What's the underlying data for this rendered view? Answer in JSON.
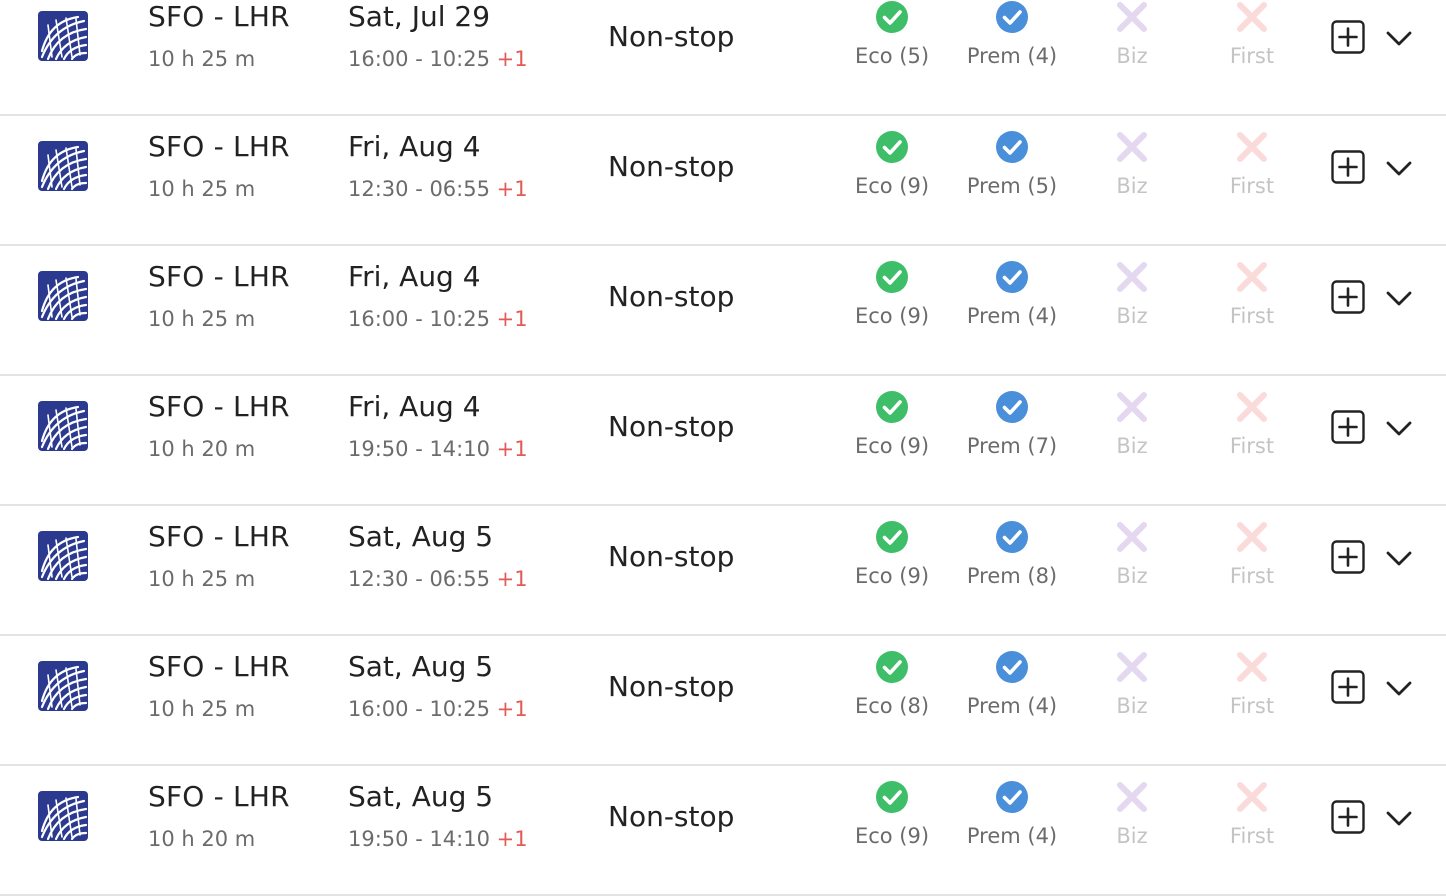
{
  "colors": {
    "airline_logo": "#2b3a8f",
    "available_eco": "#3fbe6a",
    "available_prem": "#4a8fd9",
    "unavailable_biz": "#e3d8f0",
    "unavailable_first": "#fbdada",
    "plus_day": "#e25a55",
    "divider": "#e3e3e3"
  },
  "flights": [
    {
      "route": "SFO - LHR",
      "duration": "10 h 25 m",
      "date": "Sat, Jul 29",
      "times": "16:00 - 10:25",
      "plus_day": "+1",
      "stops": "Non-stop",
      "cabins": [
        {
          "label": "Eco (5)",
          "available": true,
          "icon": "check-circle-green-icon"
        },
        {
          "label": "Prem (4)",
          "available": true,
          "icon": "check-circle-blue-icon"
        },
        {
          "label": "Biz",
          "available": false,
          "icon": "x-lavender-icon"
        },
        {
          "label": "First",
          "available": false,
          "icon": "x-pink-icon"
        }
      ]
    },
    {
      "route": "SFO - LHR",
      "duration": "10 h 25 m",
      "date": "Fri, Aug 4",
      "times": "12:30 - 06:55",
      "plus_day": "+1",
      "stops": "Non-stop",
      "cabins": [
        {
          "label": "Eco (9)",
          "available": true,
          "icon": "check-circle-green-icon"
        },
        {
          "label": "Prem (5)",
          "available": true,
          "icon": "check-circle-blue-icon"
        },
        {
          "label": "Biz",
          "available": false,
          "icon": "x-lavender-icon"
        },
        {
          "label": "First",
          "available": false,
          "icon": "x-pink-icon"
        }
      ]
    },
    {
      "route": "SFO - LHR",
      "duration": "10 h 25 m",
      "date": "Fri, Aug 4",
      "times": "16:00 - 10:25",
      "plus_day": "+1",
      "stops": "Non-stop",
      "cabins": [
        {
          "label": "Eco (9)",
          "available": true,
          "icon": "check-circle-green-icon"
        },
        {
          "label": "Prem (4)",
          "available": true,
          "icon": "check-circle-blue-icon"
        },
        {
          "label": "Biz",
          "available": false,
          "icon": "x-lavender-icon"
        },
        {
          "label": "First",
          "available": false,
          "icon": "x-pink-icon"
        }
      ]
    },
    {
      "route": "SFO - LHR",
      "duration": "10 h 20 m",
      "date": "Fri, Aug 4",
      "times": "19:50 - 14:10",
      "plus_day": "+1",
      "stops": "Non-stop",
      "cabins": [
        {
          "label": "Eco (9)",
          "available": true,
          "icon": "check-circle-green-icon"
        },
        {
          "label": "Prem (7)",
          "available": true,
          "icon": "check-circle-blue-icon"
        },
        {
          "label": "Biz",
          "available": false,
          "icon": "x-lavender-icon"
        },
        {
          "label": "First",
          "available": false,
          "icon": "x-pink-icon"
        }
      ]
    },
    {
      "route": "SFO - LHR",
      "duration": "10 h 25 m",
      "date": "Sat, Aug 5",
      "times": "12:30 - 06:55",
      "plus_day": "+1",
      "stops": "Non-stop",
      "cabins": [
        {
          "label": "Eco (9)",
          "available": true,
          "icon": "check-circle-green-icon"
        },
        {
          "label": "Prem (8)",
          "available": true,
          "icon": "check-circle-blue-icon"
        },
        {
          "label": "Biz",
          "available": false,
          "icon": "x-lavender-icon"
        },
        {
          "label": "First",
          "available": false,
          "icon": "x-pink-icon"
        }
      ]
    },
    {
      "route": "SFO - LHR",
      "duration": "10 h 25 m",
      "date": "Sat, Aug 5",
      "times": "16:00 - 10:25",
      "plus_day": "+1",
      "stops": "Non-stop",
      "cabins": [
        {
          "label": "Eco (8)",
          "available": true,
          "icon": "check-circle-green-icon"
        },
        {
          "label": "Prem (4)",
          "available": true,
          "icon": "check-circle-blue-icon"
        },
        {
          "label": "Biz",
          "available": false,
          "icon": "x-lavender-icon"
        },
        {
          "label": "First",
          "available": false,
          "icon": "x-pink-icon"
        }
      ]
    },
    {
      "route": "SFO - LHR",
      "duration": "10 h 20 m",
      "date": "Sat, Aug 5",
      "times": "19:50 - 14:10",
      "plus_day": "+1",
      "stops": "Non-stop",
      "cabins": [
        {
          "label": "Eco (9)",
          "available": true,
          "icon": "check-circle-green-icon"
        },
        {
          "label": "Prem (4)",
          "available": true,
          "icon": "check-circle-blue-icon"
        },
        {
          "label": "Biz",
          "available": false,
          "icon": "x-lavender-icon"
        },
        {
          "label": "First",
          "available": false,
          "icon": "x-pink-icon"
        }
      ]
    }
  ]
}
